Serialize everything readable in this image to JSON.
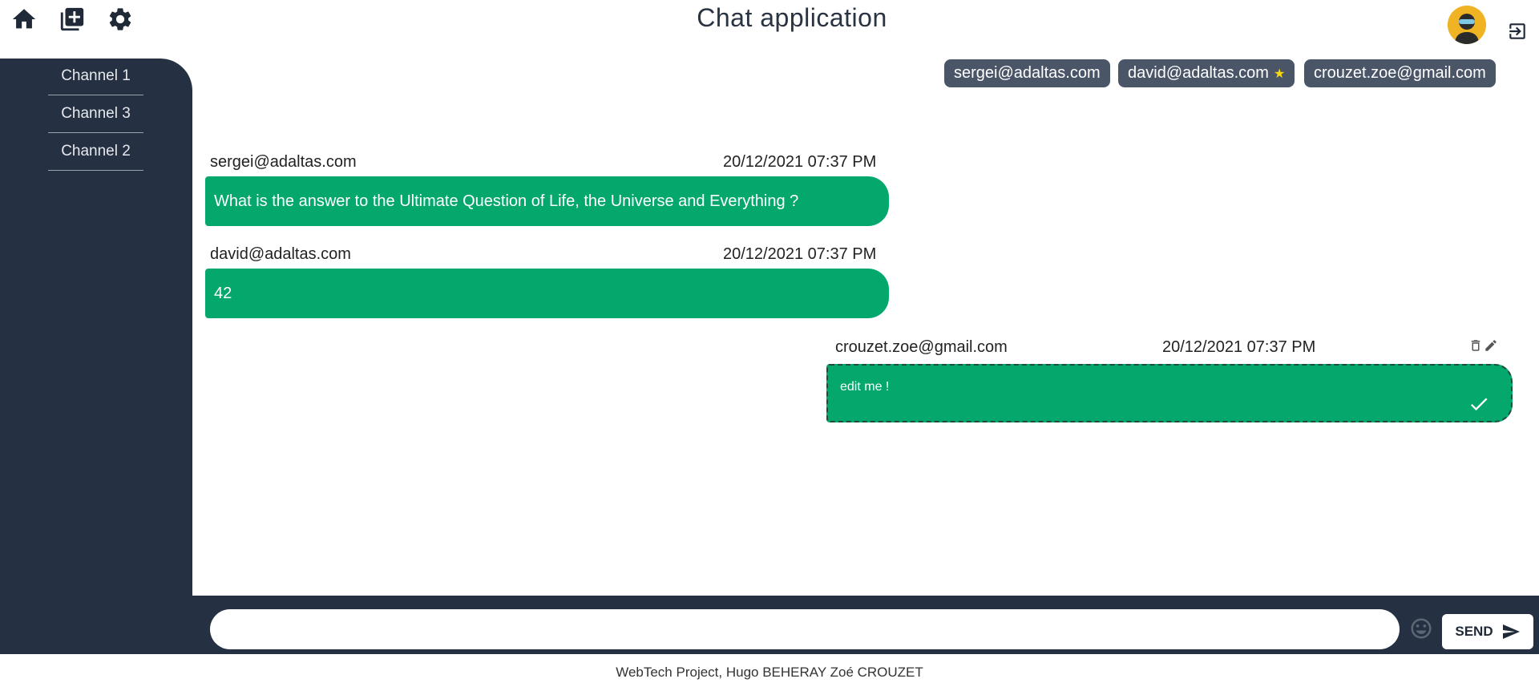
{
  "app": {
    "title": "Chat application"
  },
  "nav": {
    "home_icon": "home-icon",
    "add_channel_icon": "add-box-icon",
    "settings_icon": "gear-icon",
    "logout_icon": "logout-icon"
  },
  "sidebar": {
    "channels": [
      {
        "label": "Channel 1"
      },
      {
        "label": "Channel 3"
      },
      {
        "label": "Channel 2"
      }
    ]
  },
  "members": [
    {
      "email": "sergei@adaltas.com",
      "starred": false
    },
    {
      "email": "david@adaltas.com",
      "starred": true,
      "star": "★"
    },
    {
      "email": "crouzet.zoe@gmail.com",
      "starred": false
    }
  ],
  "messages": [
    {
      "author": "sergei@adaltas.com",
      "date": "20/12/2021 07:37 PM",
      "content": "What is the answer to the Ultimate Question of Life, the Universe and Everything ?"
    },
    {
      "author": "david@adaltas.com",
      "date": "20/12/2021 07:37 PM",
      "content": "42"
    },
    {
      "author": "crouzet.zoe@gmail.com",
      "date": "20/12/2021 07:37 PM",
      "content": "edit me !",
      "editing": true
    }
  ],
  "composer": {
    "input_value": "",
    "send_label": "SEND"
  },
  "footer": {
    "text": "WebTech Project, Hugo BEHERAY Zoé CROUZET"
  },
  "colors": {
    "sidebar": "#253142",
    "bubble": "#05a86c",
    "chip": "#4a5568",
    "star": "#f5d90a",
    "avatar": "#f0b323"
  }
}
